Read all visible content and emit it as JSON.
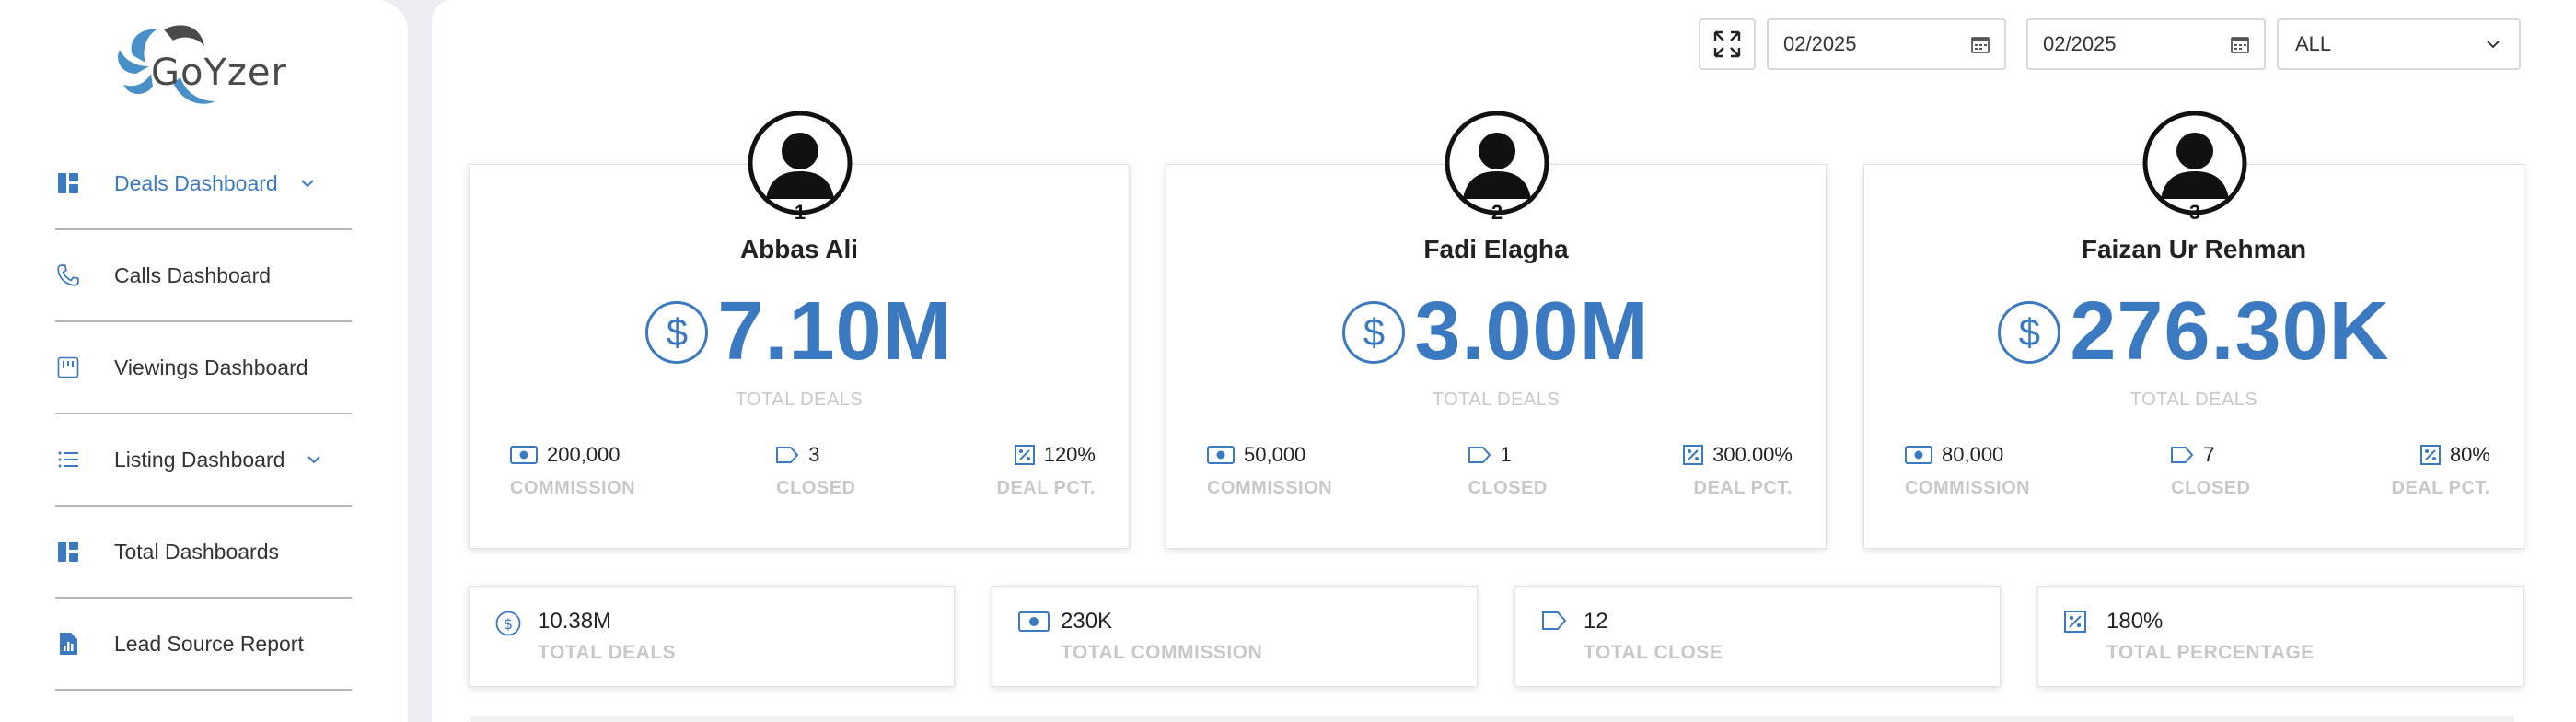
{
  "brand": {
    "name": "GoYzer"
  },
  "sidebar": {
    "items": [
      {
        "label": "Deals Dashboard",
        "icon": "dashboard-icon",
        "active": true,
        "has_chevron": true
      },
      {
        "label": "Calls Dashboard",
        "icon": "phone-icon",
        "active": false,
        "has_chevron": false
      },
      {
        "label": "Viewings Dashboard",
        "icon": "viewings-icon",
        "active": false,
        "has_chevron": false
      },
      {
        "label": "Listing Dashboard",
        "icon": "list-icon",
        "active": false,
        "has_chevron": true
      },
      {
        "label": "Total Dashboards",
        "icon": "dashboard-icon",
        "active": false,
        "has_chevron": false
      },
      {
        "label": "Lead Source Report",
        "icon": "report-icon",
        "active": false,
        "has_chevron": false
      }
    ]
  },
  "toolbar": {
    "expand_icon": "expand-icon",
    "date_from": "02/2025",
    "date_to": "02/2025",
    "filter_value": "ALL"
  },
  "agents": [
    {
      "rank": "1",
      "name": "Abbas Ali",
      "total_deals": "7.10M",
      "total_deals_label": "TOTAL DEALS",
      "commission": "200,000",
      "commission_label": "COMMISSION",
      "closed": "3",
      "closed_label": "CLOSED",
      "deal_pct": "120%",
      "deal_pct_label": "DEAL PCT."
    },
    {
      "rank": "2",
      "name": "Fadi Elagha",
      "total_deals": "3.00M",
      "total_deals_label": "TOTAL DEALS",
      "commission": "50,000",
      "commission_label": "COMMISSION",
      "closed": "1",
      "closed_label": "CLOSED",
      "deal_pct": "300.00%",
      "deal_pct_label": "DEAL PCT."
    },
    {
      "rank": "3",
      "name": "Faizan Ur Rehman",
      "total_deals": "276.30K",
      "total_deals_label": "TOTAL DEALS",
      "commission": "80,000",
      "commission_label": "COMMISSION",
      "closed": "7",
      "closed_label": "CLOSED",
      "deal_pct": "80%",
      "deal_pct_label": "DEAL PCT."
    }
  ],
  "totals": [
    {
      "value": "10.38M",
      "label": "TOTAL DEALS",
      "icon": "dollar-icon"
    },
    {
      "value": "230K",
      "label": "TOTAL COMMISSION",
      "icon": "cash-icon"
    },
    {
      "value": "12",
      "label": "TOTAL CLOSE",
      "icon": "tag-icon"
    },
    {
      "value": "180%",
      "label": "TOTAL PERCENTAGE",
      "icon": "percent-icon"
    }
  ],
  "colors": {
    "accent": "#3b7ac0",
    "muted": "#c8c8c8"
  }
}
